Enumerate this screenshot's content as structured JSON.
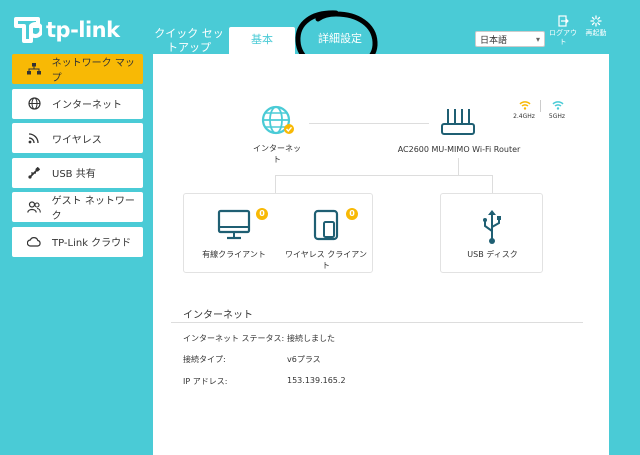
{
  "brand": {
    "name": "tp-link",
    "accent": "#4acbd6",
    "highlight": "#f8b905"
  },
  "tabs": {
    "quick_setup": "クイック セットアップ",
    "basic": "基本",
    "advanced": "詳細設定"
  },
  "header": {
    "language": "日本語",
    "logout": "ログアウト",
    "reboot": "再起動"
  },
  "sidebar": {
    "items": [
      {
        "label": "ネットワーク マップ",
        "icon": "network-map-icon",
        "active": true
      },
      {
        "label": "インターネット",
        "icon": "globe-icon",
        "active": false
      },
      {
        "label": "ワイヤレス",
        "icon": "wireless-icon",
        "active": false
      },
      {
        "label": "USB 共有",
        "icon": "usb-icon",
        "active": false
      },
      {
        "label": "ゲスト ネットワーク",
        "icon": "guest-icon",
        "active": false
      },
      {
        "label": "TP-Link クラウド",
        "icon": "cloud-icon",
        "active": false
      }
    ]
  },
  "map": {
    "internet_label": "インターネット",
    "router_label": "AC2600 MU-MIMO Wi-Fi Router",
    "wifi_24": "2.4GHz",
    "wifi_5": "5GHz",
    "wired_label": "有線クライアント",
    "wired_count": "0",
    "wireless_label": "ワイヤレス クライアント",
    "wireless_count": "0",
    "usb_label": "USB ディスク"
  },
  "internet_info": {
    "title": "インターネット",
    "rows": [
      {
        "label": "インターネット ステータス:",
        "value": "接続しました"
      },
      {
        "label": "接続タイプ:",
        "value": "v6プラス"
      },
      {
        "label": "IP アドレス:",
        "value": "153.139.165.2"
      }
    ]
  }
}
